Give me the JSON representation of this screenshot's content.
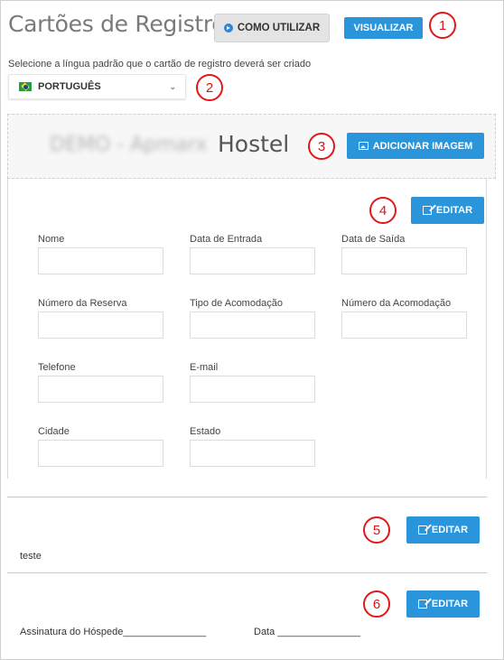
{
  "page": {
    "title": "Cartões de Registro",
    "how_to_label": "COMO UTILIZAR",
    "preview_label": "VISUALIZAR"
  },
  "language": {
    "hint": "Selecione a língua padrão que o cartão de registro deverá ser criado",
    "selected": "PORTUGUÊS"
  },
  "card_header": {
    "blurred_name": "DEMO - Apmarx",
    "name_suffix": "Hostel",
    "add_image_label": "ADICIONAR IMAGEM"
  },
  "form_section": {
    "edit_label": "EDITAR",
    "fields": [
      "Nome",
      "Data de Entrada",
      "Data de Saída",
      "Número da Reserva",
      "Tipo de Acomodação",
      "Número da Acomodação",
      "Telefone",
      "E-mail",
      "Cidade",
      "Estado"
    ]
  },
  "text_section": {
    "edit_label": "EDITAR",
    "content": "teste"
  },
  "signature_section": {
    "edit_label": "EDITAR",
    "guest_signature": "Assinatura do Hóspede_______________",
    "date_line": "Data _______________"
  },
  "markers": [
    "1",
    "2",
    "3",
    "4",
    "5",
    "6"
  ],
  "colors": {
    "primary": "#2b95db",
    "marker": "#e01818"
  }
}
